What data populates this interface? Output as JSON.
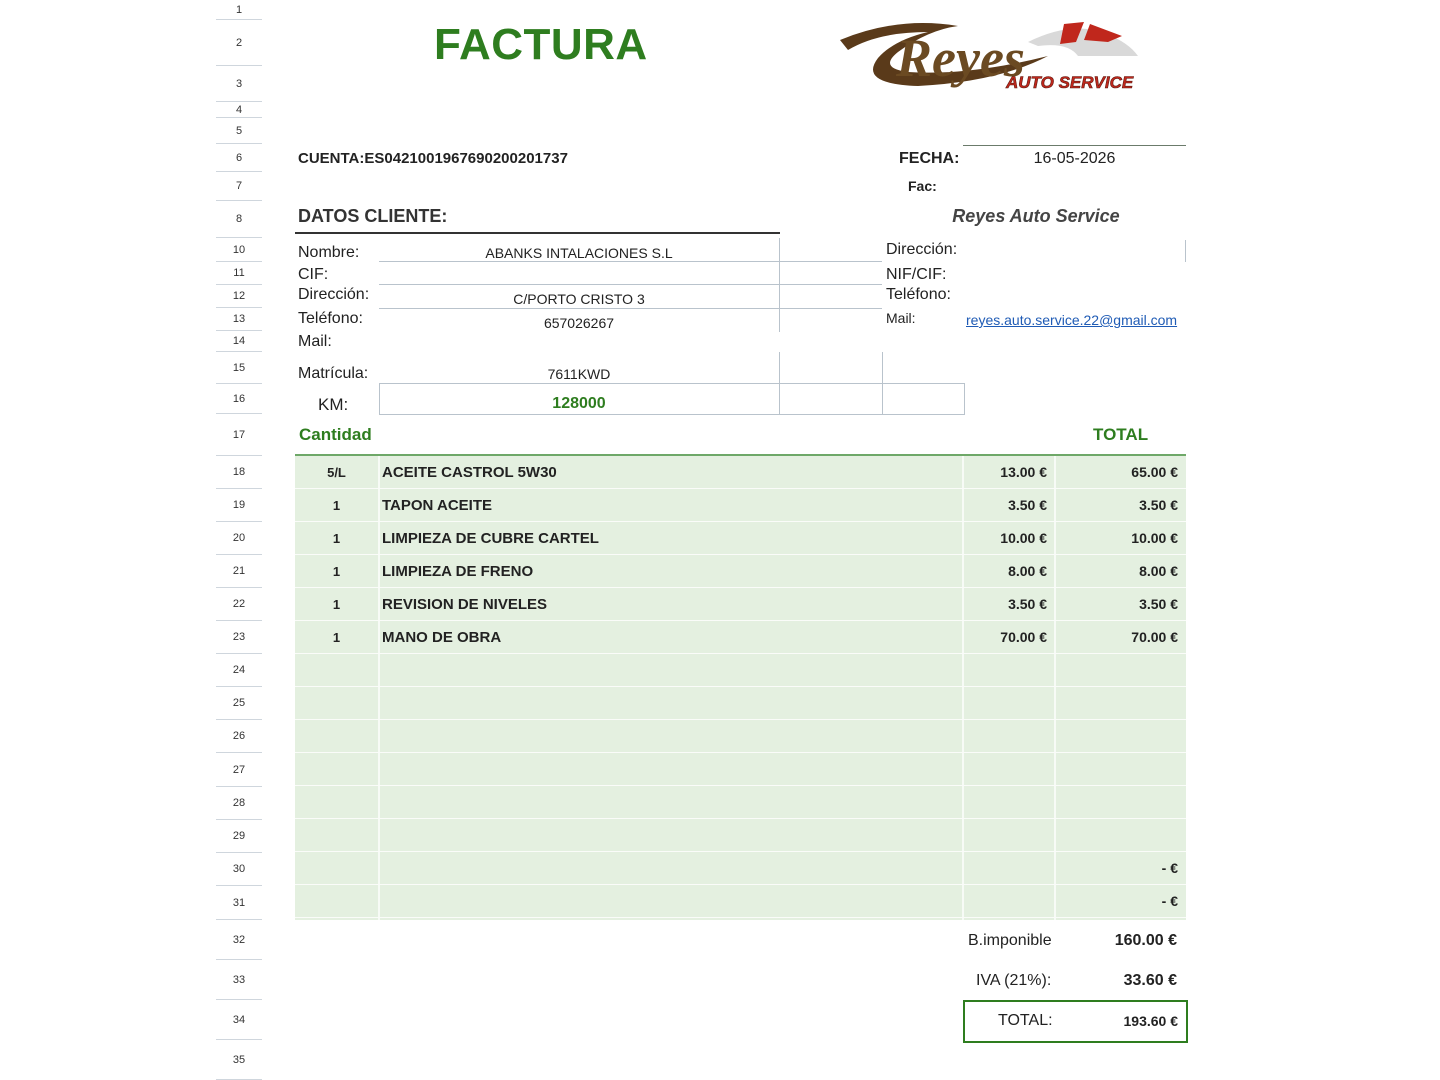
{
  "rows": [
    "1",
    "2",
    "3",
    "4",
    "5",
    "6",
    "7",
    "8",
    "10",
    "11",
    "12",
    "13",
    "14",
    "15",
    "16",
    "17",
    "18",
    "19",
    "20",
    "21",
    "22",
    "23",
    "24",
    "25",
    "26",
    "27",
    "28",
    "29",
    "30",
    "31",
    "32",
    "33",
    "34",
    "35"
  ],
  "title": "FACTURA",
  "logo": {
    "main": "Reyes",
    "sub": "AUTO SERVICE"
  },
  "cuenta": "CUENTA:ES0421001967690200201737",
  "fecha_label": "FECHA:",
  "fecha_value": "16-05-2026",
  "fac_label": "Fac:",
  "datos_cliente": "DATOS CLIENTE:",
  "company_name": "Reyes Auto Service",
  "client": {
    "nombre_label": "Nombre:",
    "nombre": "ABANKS INTALACIONES S.L",
    "cif_label": "CIF:",
    "direccion_label": "Dirección:",
    "direccion": "C/PORTO CRISTO 3",
    "telefono_label": "Teléfono:",
    "telefono": "657026267",
    "mail_label": "Mail:",
    "matricula_label": "Matrícula:",
    "matricula": "7611KWD",
    "km_label": "KM:",
    "km": "128000"
  },
  "company": {
    "direccion_label": "Dirección:",
    "nif_label": "NIF/CIF:",
    "telefono_label": "Teléfono:",
    "mail_label": "Mail:",
    "mail": "reyes.auto.service.22@gmail.com"
  },
  "table": {
    "cantidad_header": "Cantidad",
    "total_header": "TOTAL",
    "items": [
      {
        "qty": "5/L",
        "desc": "ACEITE CASTROL 5W30",
        "price": "13.00 €",
        "total": "65.00 €"
      },
      {
        "qty": "1",
        "desc": "TAPON ACEITE",
        "price": "3.50 €",
        "total": "3.50 €"
      },
      {
        "qty": "1",
        "desc": "LIMPIEZA DE CUBRE CARTEL",
        "price": "10.00 €",
        "total": "10.00 €"
      },
      {
        "qty": "1",
        "desc": "LIMPIEZA DE FRENO",
        "price": "8.00 €",
        "total": "8.00 €"
      },
      {
        "qty": "1",
        "desc": "REVISION DE NIVELES",
        "price": "3.50 €",
        "total": "3.50 €"
      },
      {
        "qty": "1",
        "desc": "MANO DE OBRA",
        "price": "70.00 €",
        "total": "70.00 €"
      },
      {
        "qty": "",
        "desc": "",
        "price": "",
        "total": ""
      },
      {
        "qty": "",
        "desc": "",
        "price": "",
        "total": ""
      },
      {
        "qty": "",
        "desc": "",
        "price": "",
        "total": ""
      },
      {
        "qty": "",
        "desc": "",
        "price": "",
        "total": ""
      },
      {
        "qty": "",
        "desc": "",
        "price": "",
        "total": ""
      },
      {
        "qty": "",
        "desc": "",
        "price": "",
        "total": ""
      },
      {
        "qty": "",
        "desc": "",
        "price": "",
        "total": "-    €"
      },
      {
        "qty": "",
        "desc": "",
        "price": "",
        "total": "-    €"
      }
    ]
  },
  "summary": {
    "base_label": "B.imponible",
    "base_value": "160.00 €",
    "iva_label": "IVA (21%):",
    "iva_value": "33.60 €",
    "total_label": "TOTAL:",
    "total_value": "193.60 €"
  },
  "colors": {
    "accent_green": "#2e7d1f",
    "table_bg": "#e4f0e0",
    "logo_brown": "#5a3a1a",
    "logo_red": "#c0271c"
  }
}
